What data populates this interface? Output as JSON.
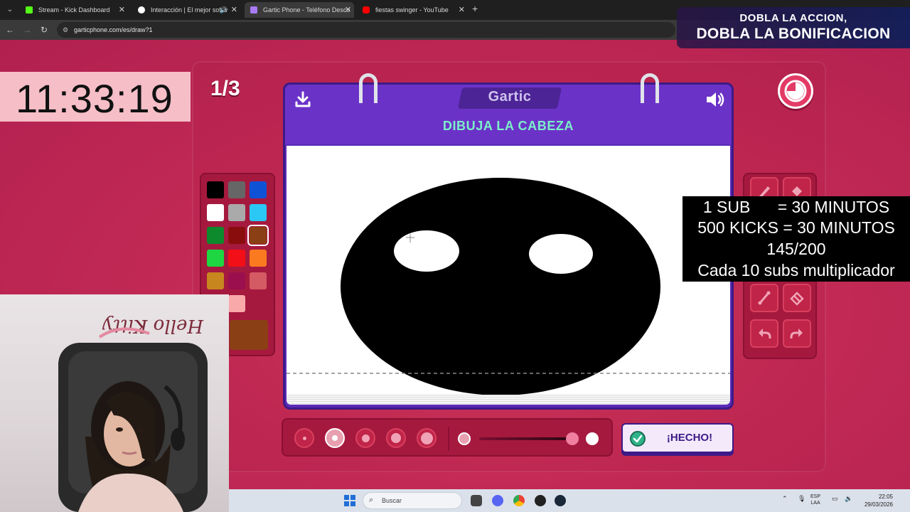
{
  "browser": {
    "tabs": [
      {
        "title": "Stream - Kick Dashboard",
        "favicon_color": "#53fc18"
      },
      {
        "title": "Interacción | El mejor softw",
        "favicon_color": "#ffffff"
      },
      {
        "title": "Gartic Phone - Teléfono Desco",
        "favicon_color": "#a77bf3"
      },
      {
        "title": "fiestas swinger - YouTube",
        "favicon_color": "#ff0000"
      }
    ],
    "new_tab": "+",
    "url": "garticphone.com/es/draw?1"
  },
  "overlay": {
    "clock": "11:33:19",
    "round": "1/3",
    "promo_line1": "DOBLA LA ACCION,",
    "promo_line2": "DOBLA LA BONIFICACION",
    "goal_lines": [
      "1 SUB      = 30 MINUTOS",
      "500 KICKS = 30 MINUTOS",
      "145/200",
      "Cada 10 subs multiplicador"
    ]
  },
  "game": {
    "logo": "Gartic",
    "prompt": "DIBUJA LA CABEZA",
    "done_label": "¡HECHO!",
    "selected_color": "#8b3f14",
    "palette": [
      "#000000",
      "#666666",
      "#1052d6",
      "#ffffff",
      "#aaaaaa",
      "#2cc8f5",
      "#0d8a2c",
      "#8a0d0d",
      "#8b3f14",
      "#1ed641",
      "#f20f17",
      "#fc7a1f",
      "#c8861e",
      "#9b0f4e",
      "#d45a63",
      "#f50f8a",
      "#f9a9a9"
    ],
    "brush_sizes": [
      1,
      2,
      3,
      4,
      5
    ],
    "selected_brush": 2,
    "opacity": 1.0,
    "tools": [
      "pencil-icon",
      "fill-icon",
      "line-icon",
      "eraser-icon",
      "undo-icon",
      "redo-icon"
    ]
  },
  "taskbar": {
    "search_placeholder": "Buscar",
    "lang_line1": "ESP",
    "lang_line2": "LAA",
    "time": "22:05",
    "date": "29/03/2026"
  }
}
